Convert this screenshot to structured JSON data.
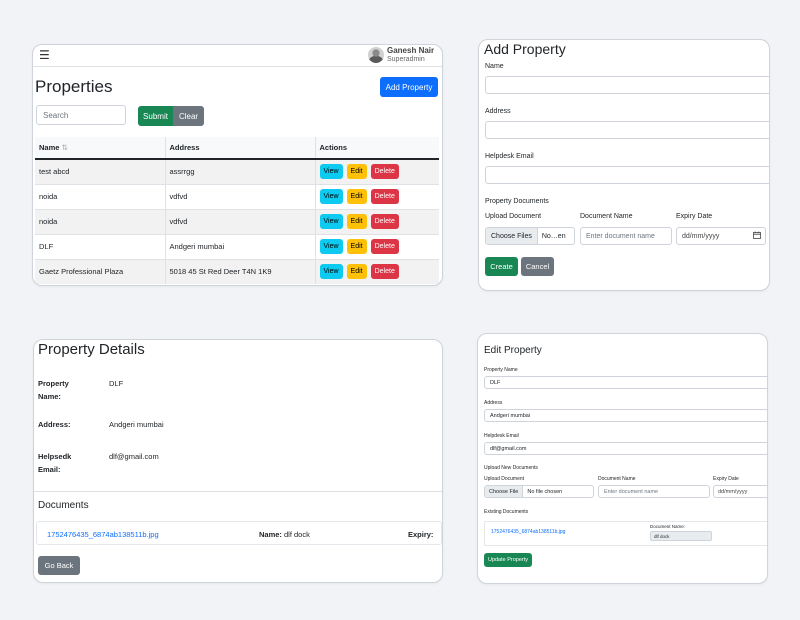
{
  "properties_list": {
    "header": {
      "menu_icon": "hamburger-icon",
      "user_name": "Ganesh Nair",
      "user_role": "Superadmin"
    },
    "title": "Properties",
    "add_button": "Add Property",
    "search": {
      "placeholder": "Search",
      "value": ""
    },
    "submit_button": "Submit",
    "clear_button": "Clear",
    "columns": [
      "Name",
      "Address",
      "Actions"
    ],
    "sort_icon": "sort-icon",
    "rows": [
      {
        "name": "test abcd",
        "address": "assrrgg"
      },
      {
        "name": "noida",
        "address": "vdfvd"
      },
      {
        "name": "noida",
        "address": "vdfvd"
      },
      {
        "name": "DLF",
        "address": "Andgeri mumbai"
      },
      {
        "name": "Gaetz Professional Plaza",
        "address": "5018 45 St Red Deer T4N 1K9"
      }
    ],
    "actions": {
      "view": "View",
      "edit": "Edit",
      "delete": "Delete"
    }
  },
  "add_property": {
    "title": "Add Property",
    "name_label": "Name",
    "address_label": "Address",
    "helpdesk_label": "Helpdesk Email",
    "documents_label": "Property Documents",
    "upload_label": "Upload Document",
    "docname_label": "Document Name",
    "expiry_label": "Expiry Date",
    "choose_files": "Choose Files",
    "file_status": "No…en",
    "docname_placeholder": "Enter document name",
    "date_placeholder": "dd/mm/yyyy",
    "create_button": "Create",
    "cancel_button": "Cancel"
  },
  "property_details": {
    "title": "Property Details",
    "property_name_label": "Property Name:",
    "property_name": "DLF",
    "address_label": "Address:",
    "address": "Andgeri mumbai",
    "helpdesk_label": "Helpsedk Email:",
    "helpdesk_email": "dlf@gmail.com",
    "documents_title": "Documents",
    "document": {
      "file": "1752476435_6874ab138511b.jpg",
      "name_label": "Name:",
      "name": "dlf dock",
      "expiry_label": "Expiry:"
    },
    "go_back_button": "Go Back"
  },
  "edit_property": {
    "title": "Edit Property",
    "name_label": "Property Name",
    "name_value": "DLF",
    "address_label": "Address",
    "address_value": "Andgeri mumbai",
    "helpdesk_label": "Helpdesk Email",
    "helpdesk_value": "dlf@gmail.com",
    "upload_new_label": "Upload New Documents",
    "upload_label": "Upload Document",
    "docname_label": "Document Name",
    "expiry_label": "Expiry Date",
    "choose_file": "Choose File",
    "file_status": "No file chosen",
    "docname_placeholder": "Enter document name",
    "date_placeholder": "dd/mm/yyyy",
    "existing_label": "Existing Documents",
    "existing_file": "1752476435_6874ab138511b.jpg",
    "existing_name_label": "Document Name:",
    "existing_name": "dlf dock",
    "update_button": "Update Property"
  },
  "colors": {
    "primary": "#0d6efd",
    "success": "#198754",
    "secondary": "#6c757d",
    "info": "#0dcaf0",
    "warning": "#ffc107",
    "danger": "#dc3545"
  }
}
